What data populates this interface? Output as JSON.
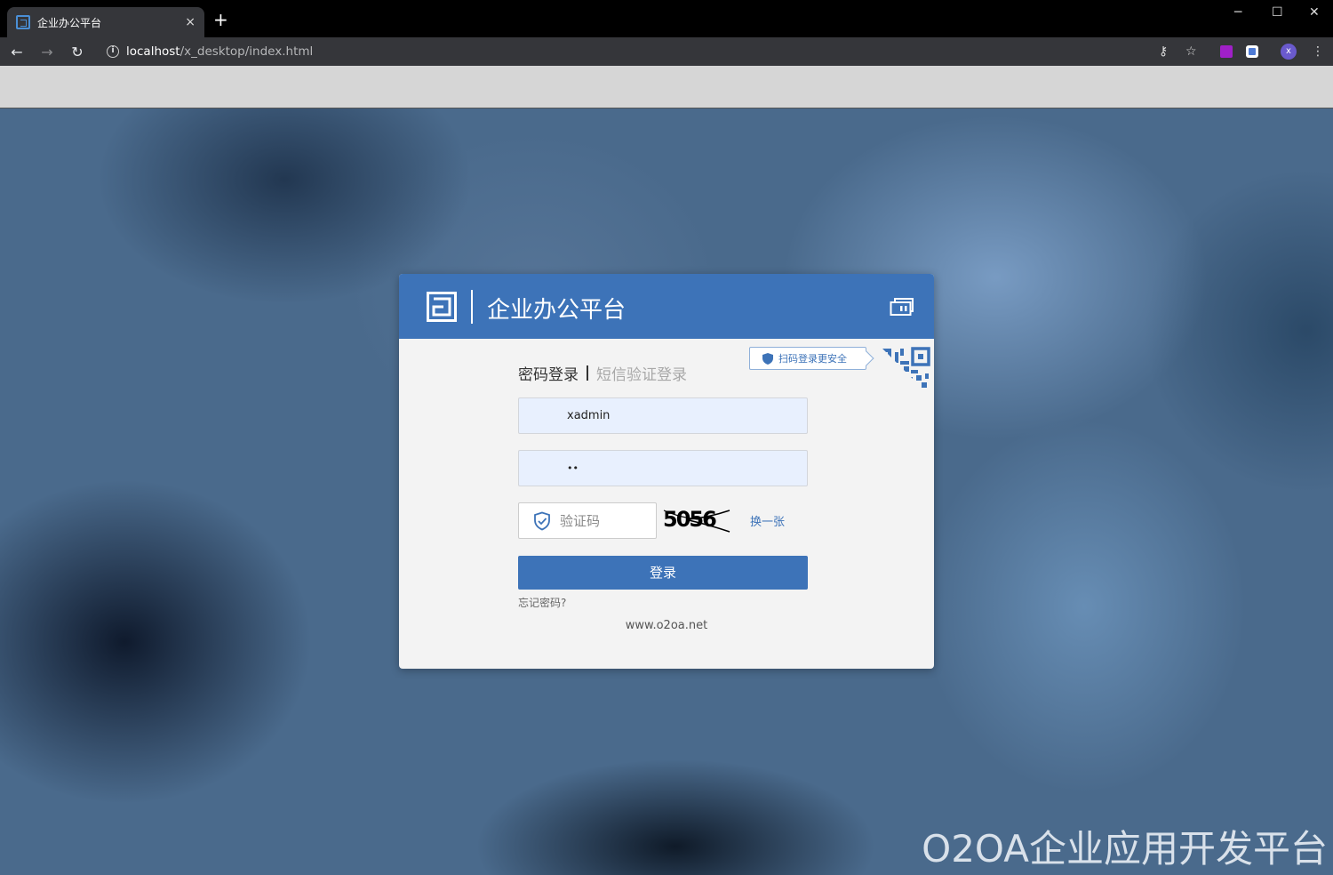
{
  "browser": {
    "tab_title": "企业办公平台",
    "tab_close": "×",
    "new_tab": "+",
    "window_controls": [
      "─",
      "☐",
      "✕"
    ],
    "back": "←",
    "forward": "→",
    "reload": "↻",
    "url_host": "localhost",
    "url_path": "/x_desktop/index.html",
    "key_icon": "⚷",
    "star_icon": "☆",
    "avatar_letter": "x",
    "menu_icon": "⋮"
  },
  "login": {
    "header_title": "企业办公平台",
    "qr_tip": "扫码登录更安全",
    "tab_password": "密码登录",
    "tab_sms": "短信验证登录",
    "username_value": "xadmin",
    "password_value": "••",
    "captcha_placeholder": "验证码",
    "captcha_text": "5056",
    "refresh_captcha": "换一张",
    "login_button": "登录",
    "forgot_password": "忘记密码?",
    "site": "www.o2oa.net"
  },
  "watermark": "O2OA企业应用开发平台",
  "colors": {
    "brand_blue": "#3d73b8",
    "input_bg": "#e8f0fe",
    "card_bg": "#f3f3f3"
  }
}
